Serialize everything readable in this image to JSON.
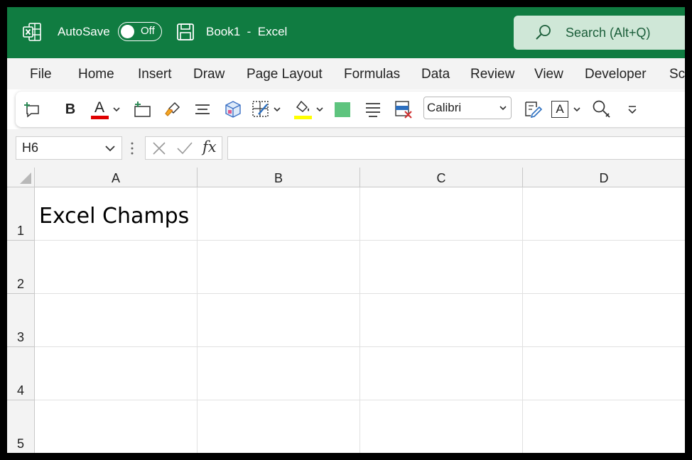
{
  "titlebar": {
    "autosave_label": "AutoSave",
    "autosave_state": "Off",
    "doc_title": "Book1  -  Excel",
    "search_placeholder": "Search (Alt+Q)",
    "bg_color": "#107c41"
  },
  "menu": {
    "items": [
      "File",
      "Home",
      "Insert",
      "Draw",
      "Page Layout",
      "Formulas",
      "Data",
      "Review",
      "View",
      "Developer",
      "Sc"
    ]
  },
  "toolbar": {
    "icons": [
      "new-comment-icon",
      "bold-icon",
      "font-color-icon",
      "insert-cells-icon",
      "format-painter-icon",
      "align-center-icon",
      "3d-model-icon",
      "borders-icon",
      "fill-color-icon",
      "green-fill-icon",
      "justify-icon",
      "delete-cells-icon",
      "font-dropdown",
      "sensitivity-icon",
      "text-box-icon",
      "find-icon",
      "customize-toolbar-icon"
    ],
    "bold_label": "B",
    "font_color_letter": "A",
    "textbox_letter": "A",
    "font_name": "Calibri",
    "font_color_hex": "#e00000",
    "fill_color_hex": "#ffff00",
    "green_fill_hex": "#5ec47e"
  },
  "formula_bar": {
    "name_box": "H6",
    "fx_label": "fx",
    "formula_value": ""
  },
  "sheet": {
    "columns": [
      "A",
      "B",
      "C",
      "D"
    ],
    "rows": [
      "1",
      "2",
      "3",
      "4",
      "5"
    ],
    "cells": {
      "A1": "Excel Champs"
    }
  }
}
